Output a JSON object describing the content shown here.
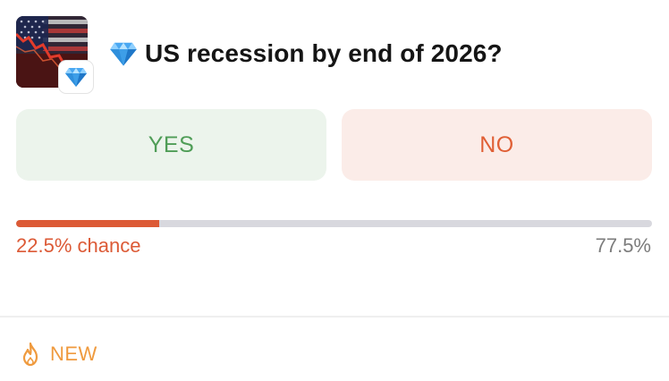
{
  "market": {
    "title_icon": "gem-icon",
    "title": "US recession by end of 2026?",
    "thumbnail_icon": "us-flag-stock-chart-image",
    "badge_icon": "gem-icon"
  },
  "outcomes": {
    "yes_label": "YES",
    "no_label": "NO"
  },
  "odds": {
    "yes_percent_text": "22.5%",
    "yes_suffix": "chance",
    "no_percent_text": "77.5%",
    "yes_fraction": 0.225
  },
  "footer": {
    "icon": "flame-icon",
    "label": "NEW"
  },
  "colors": {
    "yes_text": "#4f9d57",
    "yes_bg": "#ecf4ec",
    "no_text": "#e05f35",
    "no_bg": "#fbece8",
    "progress_fill": "#dc5a36",
    "progress_track": "#d8d8de",
    "footer_accent": "#ef9a3e"
  }
}
